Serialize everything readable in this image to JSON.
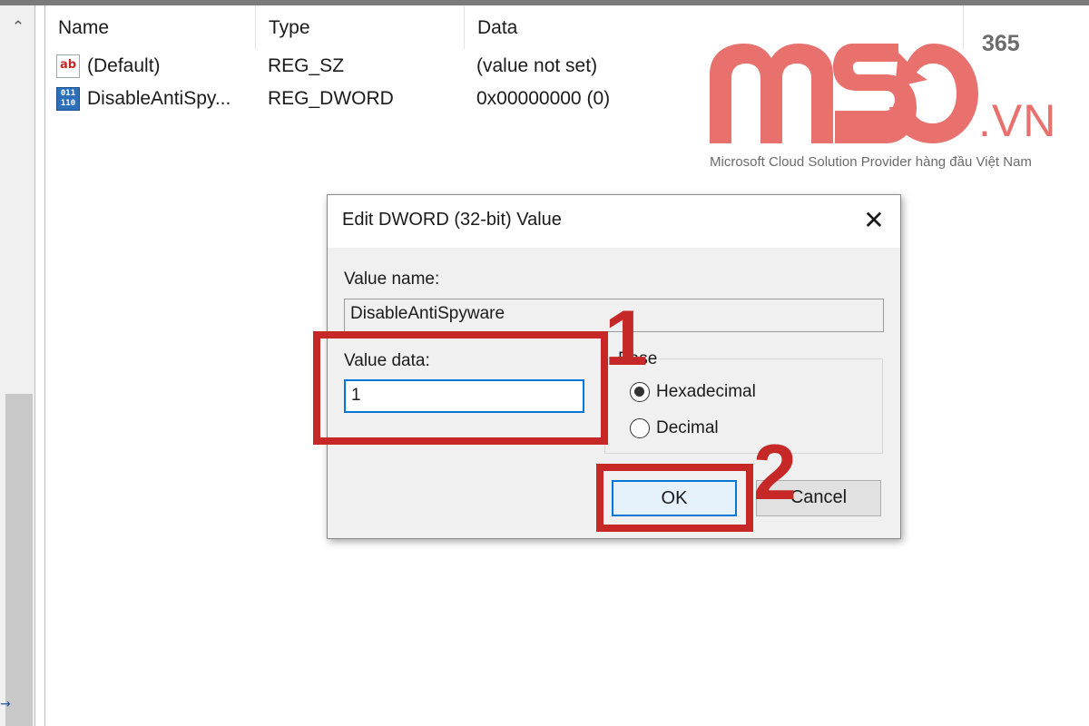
{
  "registry": {
    "columns": {
      "name": "Name",
      "type": "Type",
      "data": "Data"
    },
    "rows": [
      {
        "icon": "string-value-icon",
        "name": "(Default)",
        "type": "REG_SZ",
        "data": "(value not set)"
      },
      {
        "icon": "dword-value-icon",
        "name": "DisableAntiSpy...",
        "type": "REG_DWORD",
        "data": "0x00000000 (0)"
      }
    ]
  },
  "logo": {
    "brand": "MSO",
    "superscript": "365",
    "suffix": ".VN",
    "tagline": "Microsoft Cloud Solution Provider hàng đầu Việt Nam",
    "color": "#e8706d"
  },
  "dialog": {
    "title": "Edit DWORD (32-bit) Value",
    "value_name_label": "Value name:",
    "value_name": "DisableAntiSpyware",
    "value_data_label": "Value data:",
    "value_data": "1",
    "base_label": "Base",
    "base_options": [
      {
        "label": "Hexadecimal",
        "selected": true
      },
      {
        "label": "Decimal",
        "selected": false
      }
    ],
    "ok_label": "OK",
    "cancel_label": "Cancel"
  },
  "annotations": {
    "step1": "1",
    "step2": "2",
    "color": "#c62828"
  }
}
